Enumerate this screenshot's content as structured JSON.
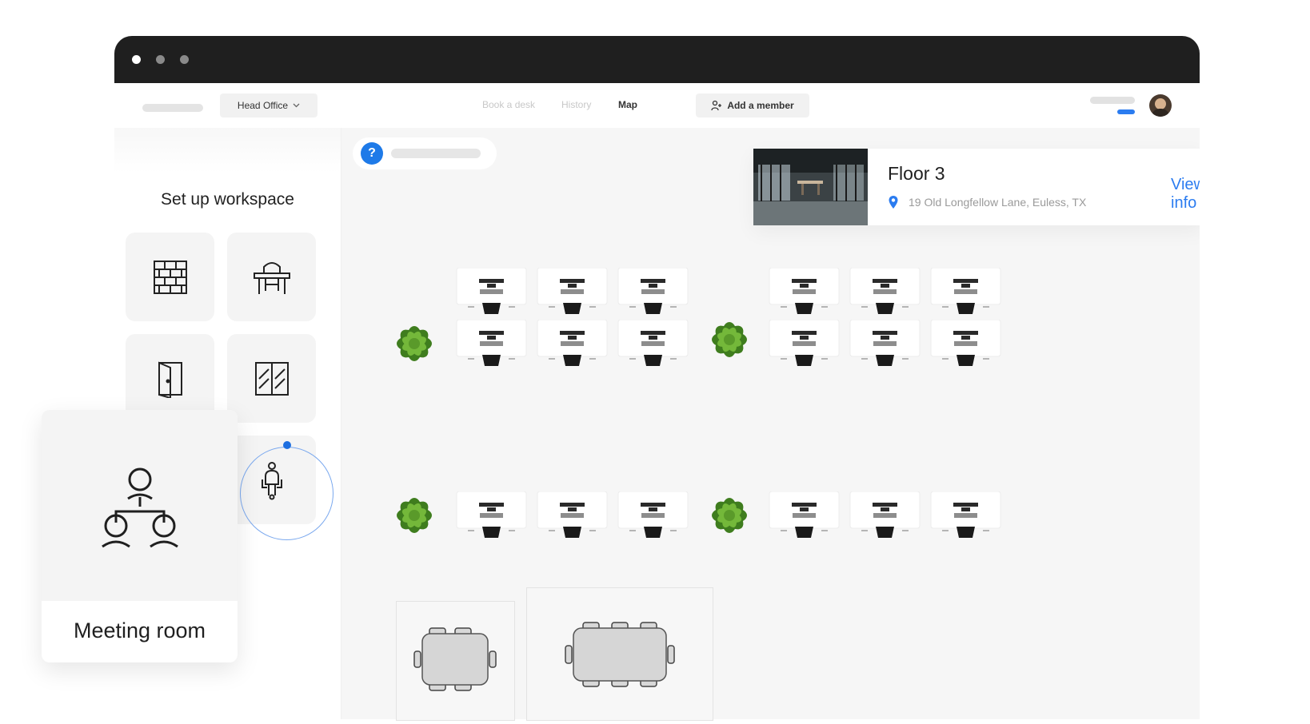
{
  "window": {
    "dots": [
      "#ffffff",
      "#8a8a8a",
      "#8a8a8a"
    ]
  },
  "topnav": {
    "office": "Head Office",
    "links": [
      "Book a desk",
      "History",
      "Map"
    ],
    "active_link": "Map",
    "add_member": "Add a member",
    "accent": "#2b7cf0"
  },
  "sidebar": {
    "title": "Set up workspace",
    "tools": [
      "wall-icon",
      "desk-icon",
      "door-icon",
      "window-icon",
      "meeting-room-icon",
      "person-icon"
    ]
  },
  "floor": {
    "title": "Floor 3",
    "address": "19 Old Longfellow Lane, Euless, TX",
    "view_info": "View info"
  },
  "meeting_tooltip": {
    "label": "Meeting room"
  }
}
